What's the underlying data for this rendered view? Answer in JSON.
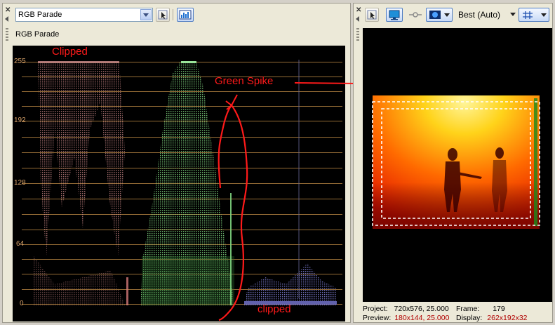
{
  "left_pane": {
    "scope_selector": {
      "value": "RGB Parade"
    },
    "title": "RGB Parade",
    "y_axis_labels": [
      "255",
      "192",
      "128",
      "64",
      "0"
    ],
    "annotations": {
      "clipped_top": "Clipped",
      "green_spike": "Green Spike",
      "clipped_bottom": "clipped"
    }
  },
  "right_pane": {
    "quality_label": "Best (Auto)",
    "status": {
      "project_label": "Project:",
      "project_value": "720x576, 25.000",
      "frame_label": "Frame:",
      "frame_value": "179",
      "preview_label": "Preview:",
      "preview_value": "180x144, 25.000",
      "display_label": "Display:",
      "display_value": "262x192x32"
    }
  },
  "colors": {
    "annotation_red": "#ff1a1a",
    "red_channel": "#c87878",
    "green_channel": "#78c878",
    "blue_channel": "#7a7ad8",
    "grid": "#b08040"
  }
}
